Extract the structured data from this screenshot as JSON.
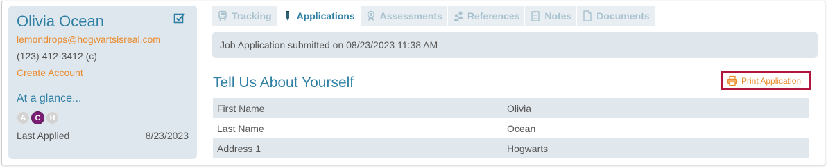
{
  "candidate": {
    "name": "Olivia Ocean",
    "email": "lemondrops@hogwartsisreal.com",
    "phone": "(123) 412-3412 (c)",
    "create_account_label": "Create Account"
  },
  "glance": {
    "title": "At a glance...",
    "badges": [
      {
        "letter": "A",
        "active": false
      },
      {
        "letter": "C",
        "active": true
      },
      {
        "letter": "H",
        "active": false
      }
    ],
    "last_applied_label": "Last Applied",
    "last_applied_date": "8/23/2023"
  },
  "tabs": [
    {
      "label": "Tracking",
      "icon": "train-icon",
      "active": false
    },
    {
      "label": "Applications",
      "icon": "pencil-icon",
      "active": true
    },
    {
      "label": "Assessments",
      "icon": "award-icon",
      "active": false
    },
    {
      "label": "References",
      "icon": "people-icon",
      "active": false
    },
    {
      "label": "Notes",
      "icon": "notepad-icon",
      "active": false
    },
    {
      "label": "Documents",
      "icon": "document-icon",
      "active": false
    }
  ],
  "banner": {
    "text": "Job Application submitted on 08/23/2023 11:38 AM"
  },
  "section": {
    "title": "Tell Us About Yourself",
    "print_label": "Print Application"
  },
  "fields": [
    {
      "label": "First Name",
      "value": "Olivia"
    },
    {
      "label": "Last Name",
      "value": "Ocean"
    },
    {
      "label": "Address 1",
      "value": "Hogwarts"
    }
  ],
  "colors": {
    "accent_blue": "#2e7fa3",
    "link_orange": "#e98b2e",
    "badge_active": "#7a1f73",
    "highlight_border": "#b0163e"
  }
}
